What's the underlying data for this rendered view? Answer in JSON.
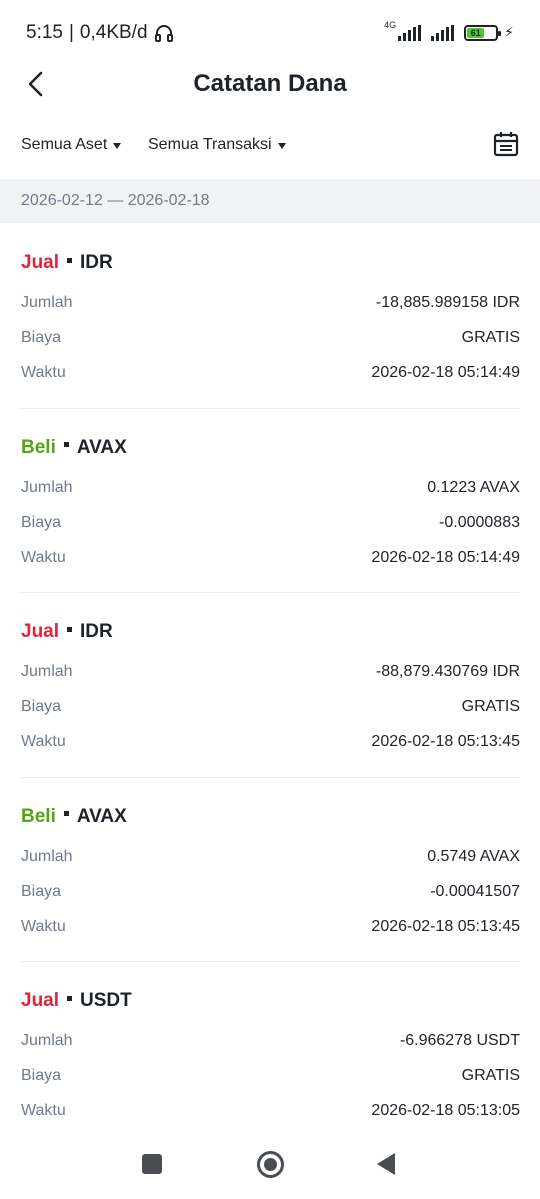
{
  "status_bar": {
    "time": "5:15",
    "separator": "|",
    "net_speed": "0,4KB/d",
    "network_type": "4G",
    "battery_level": "61",
    "icons": [
      "headset-icon",
      "signal-icon",
      "battery-icon",
      "charging-icon"
    ]
  },
  "header": {
    "title": "Catatan Dana",
    "back_icon": "chevron-left-icon"
  },
  "filters": {
    "asset": "Semua Aset",
    "transaction": "Semua Transaksi",
    "calendar_icon": "calendar-icon"
  },
  "date_range": "2026-02-12 — 2026-02-18",
  "records": [
    {
      "type": "Jual",
      "side": "sell",
      "asset": "IDR",
      "amount_label": "Jumlah",
      "amount": "-18,885.989158 IDR",
      "fee_label": "Biaya",
      "fee": "GRATIS",
      "time_label": "Waktu",
      "time": "2026-02-18 05:14:49"
    },
    {
      "type": "Beli",
      "side": "buy",
      "asset": "AVAX",
      "amount_label": "Jumlah",
      "amount": "0.1223 AVAX",
      "fee_label": "Biaya",
      "fee": "-0.0000883",
      "time_label": "Waktu",
      "time": "2026-02-18 05:14:49"
    },
    {
      "type": "Jual",
      "side": "sell",
      "asset": "IDR",
      "amount_label": "Jumlah",
      "amount": "-88,879.430769 IDR",
      "fee_label": "Biaya",
      "fee": "GRATIS",
      "time_label": "Waktu",
      "time": "2026-02-18 05:13:45"
    },
    {
      "type": "Beli",
      "side": "buy",
      "asset": "AVAX",
      "amount_label": "Jumlah",
      "amount": "0.5749 AVAX",
      "fee_label": "Biaya",
      "fee": "-0.00041507",
      "time_label": "Waktu",
      "time": "2026-02-18 05:13:45"
    },
    {
      "type": "Jual",
      "side": "sell",
      "asset": "USDT",
      "amount_label": "Jumlah",
      "amount": "-6.966278 USDT",
      "fee_label": "Biaya",
      "fee": "GRATIS",
      "time_label": "Waktu",
      "time": "2026-02-18 05:13:05"
    }
  ],
  "colors": {
    "sell": "#d9263a",
    "buy": "#53a611",
    "label_gray": "#707a8a",
    "band_bg": "#f1f2f4"
  },
  "nav_bar": {
    "icons": [
      "recents-square-icon",
      "home-circle-icon",
      "back-triangle-icon"
    ]
  }
}
